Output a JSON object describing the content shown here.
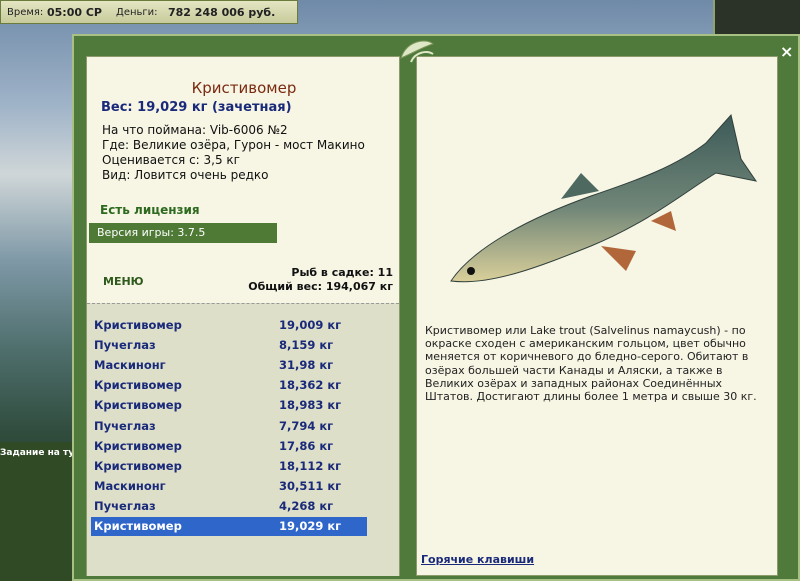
{
  "topbar": {
    "time_label": "Время:",
    "time_value": "05:00 СР",
    "money_label": "Деньги:",
    "money_value": "782 248 006 руб."
  },
  "window": {
    "close": "×"
  },
  "fish": {
    "title": "Кристивомер",
    "weight_line": "Вес: 19,029 кг (зачетная)",
    "caught_on": "На что поймана: Vib-6006 №2",
    "where": "Где: Великие озёра, Гурон - мост Макино",
    "rated_from": "Оценивается с: 3,5 кг",
    "kind": "Вид: Ловится очень редко",
    "license": "Есть лицензия",
    "version": "Версия игры: 3.7.5"
  },
  "menu_label": "МЕНЮ",
  "cage": {
    "count": "Рыб в садке: 11",
    "total": "Общий вес: 194,067 кг"
  },
  "catches": [
    {
      "name": "Кристивомер",
      "weight": "19,009 кг"
    },
    {
      "name": "Пучеглаз",
      "weight": "8,159 кг"
    },
    {
      "name": "Маскинонг",
      "weight": "31,98 кг"
    },
    {
      "name": "Кристивомер",
      "weight": "18,362 кг"
    },
    {
      "name": "Кристивомер",
      "weight": "18,983 кг"
    },
    {
      "name": "Пучеглаз",
      "weight": "7,794 кг"
    },
    {
      "name": "Кристивомер",
      "weight": "17,86 кг"
    },
    {
      "name": "Кристивомер",
      "weight": "18,112 кг"
    },
    {
      "name": "Маскинонг",
      "weight": "30,511 кг"
    },
    {
      "name": "Пучеглаз",
      "weight": "4,268 кг"
    },
    {
      "name": "Кристивомер",
      "weight": "19,029 кг"
    }
  ],
  "selected_index": 10,
  "description": "Кристивомер или Lake trout (Salvelinus namaycush) - по окраске сходен с американским гольцом, цвет обычно меняется от коричневого до бледно-серого. Обитают в озёрах большей части Канады и Аляски, а также в Великих озёрах и западных районах Соединённых Штатов. Достигают длины более 1 метра и свыше 30 кг.",
  "hotkeys": "Горячие клавиши",
  "task_label": "Задание на тур",
  "colors": {
    "accent": "#2f66c9",
    "title": "#7a2a10",
    "list_text": "#1a2a7a"
  }
}
